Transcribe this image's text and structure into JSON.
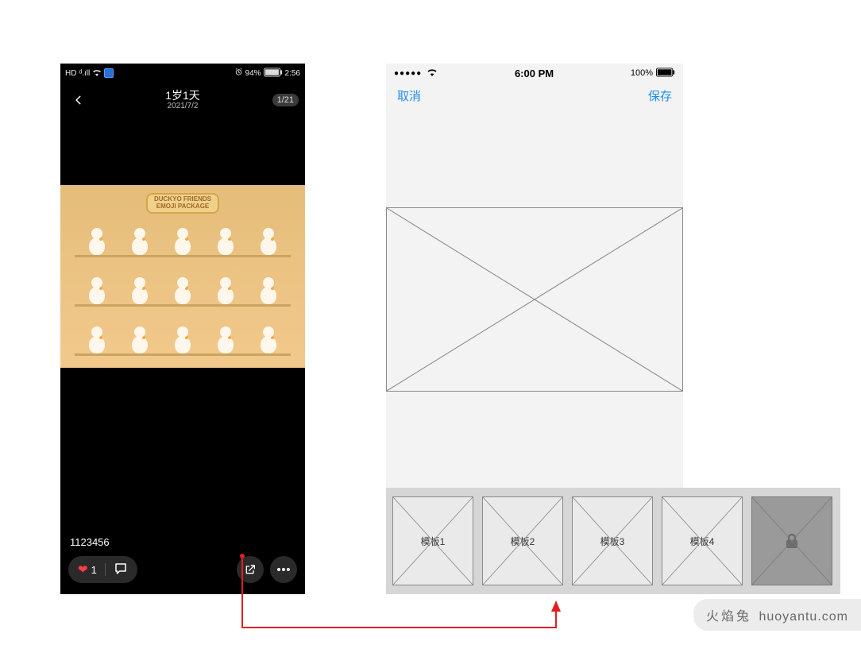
{
  "left": {
    "statusbar": {
      "hd": "HD",
      "signal": "ᵈ.ıll",
      "wifi_icon": "wifi",
      "service_icon": "⬚",
      "alarm_icon": "⏰",
      "battery_pct": "94%",
      "time": "2:56"
    },
    "nav": {
      "title": "1岁1天",
      "subtitle": "2021/7/2",
      "counter": "1/21"
    },
    "photo": {
      "sign_line1": "DUCKYO FRIENDS",
      "sign_line2": "EMOJI PACKAGE"
    },
    "caption": "1123456",
    "actions": {
      "like_count": "1"
    }
  },
  "right": {
    "statusbar": {
      "time": "6:00 PM",
      "battery_pct": "100%"
    },
    "nav": {
      "cancel": "取消",
      "save": "保存"
    },
    "templates": [
      "模板1",
      "模板2",
      "模板3",
      "模板4"
    ]
  },
  "watermark": {
    "zh": "火焰兔",
    "en": "huoyantu.com"
  }
}
